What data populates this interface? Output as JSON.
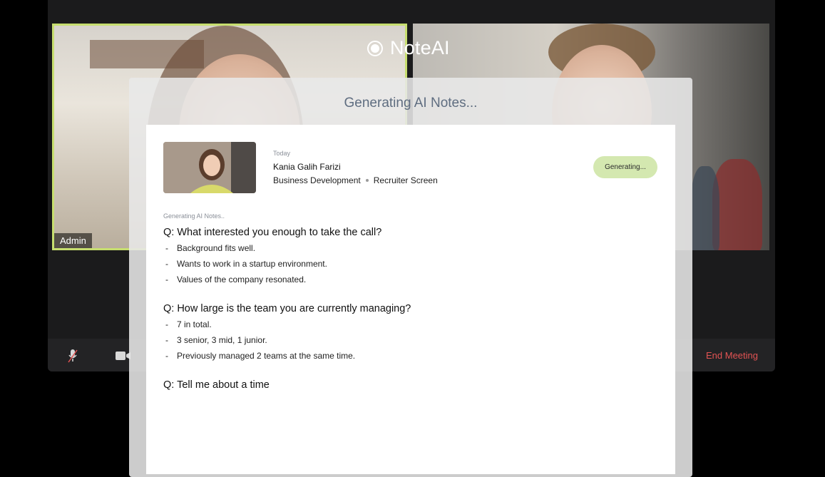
{
  "meeting": {
    "participant_label": "Admin",
    "end_meeting_label": "End Meeting"
  },
  "brand": {
    "name": "NoteAI"
  },
  "panel": {
    "title": "Generating AI Notes..."
  },
  "candidate": {
    "date": "Today",
    "name": "Kania Galih Farizi",
    "department": "Business Development",
    "stage": "Recruiter Screen",
    "status": "Generating..."
  },
  "notes": {
    "caption": "Generating AI Notes..",
    "questions": [
      {
        "q": "Q: What interested you enough to take the call?",
        "answers": [
          "Background fits well.",
          "Wants to work in a startup environment.",
          "Values of the company resonated."
        ]
      },
      {
        "q": "Q: How large is the team you are currently managing?",
        "answers": [
          "7 in total.",
          "3 senior, 3 mid, 1 junior.",
          "Previously managed 2 teams at the same time."
        ]
      },
      {
        "q": "Q: Tell me about a time",
        "answers": []
      }
    ]
  },
  "colors": {
    "accent_green": "#c7de6f",
    "end_meeting_red": "#e25353",
    "status_pill": "#d4e8b0"
  }
}
